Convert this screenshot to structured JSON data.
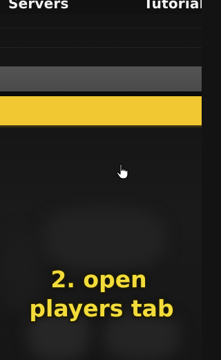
{
  "top_nav": {
    "left_label": "Servers",
    "right_label": "Tutorial"
  },
  "caption": {
    "line1": "2. open",
    "line2": "players tab"
  },
  "colors": {
    "background": "#141414",
    "gray_bar": "#4f4f4f",
    "yellow_bar": "#f2c832",
    "caption_text": "#f3dc3a"
  },
  "icons": {
    "pointer": "hand-pointer-icon"
  }
}
